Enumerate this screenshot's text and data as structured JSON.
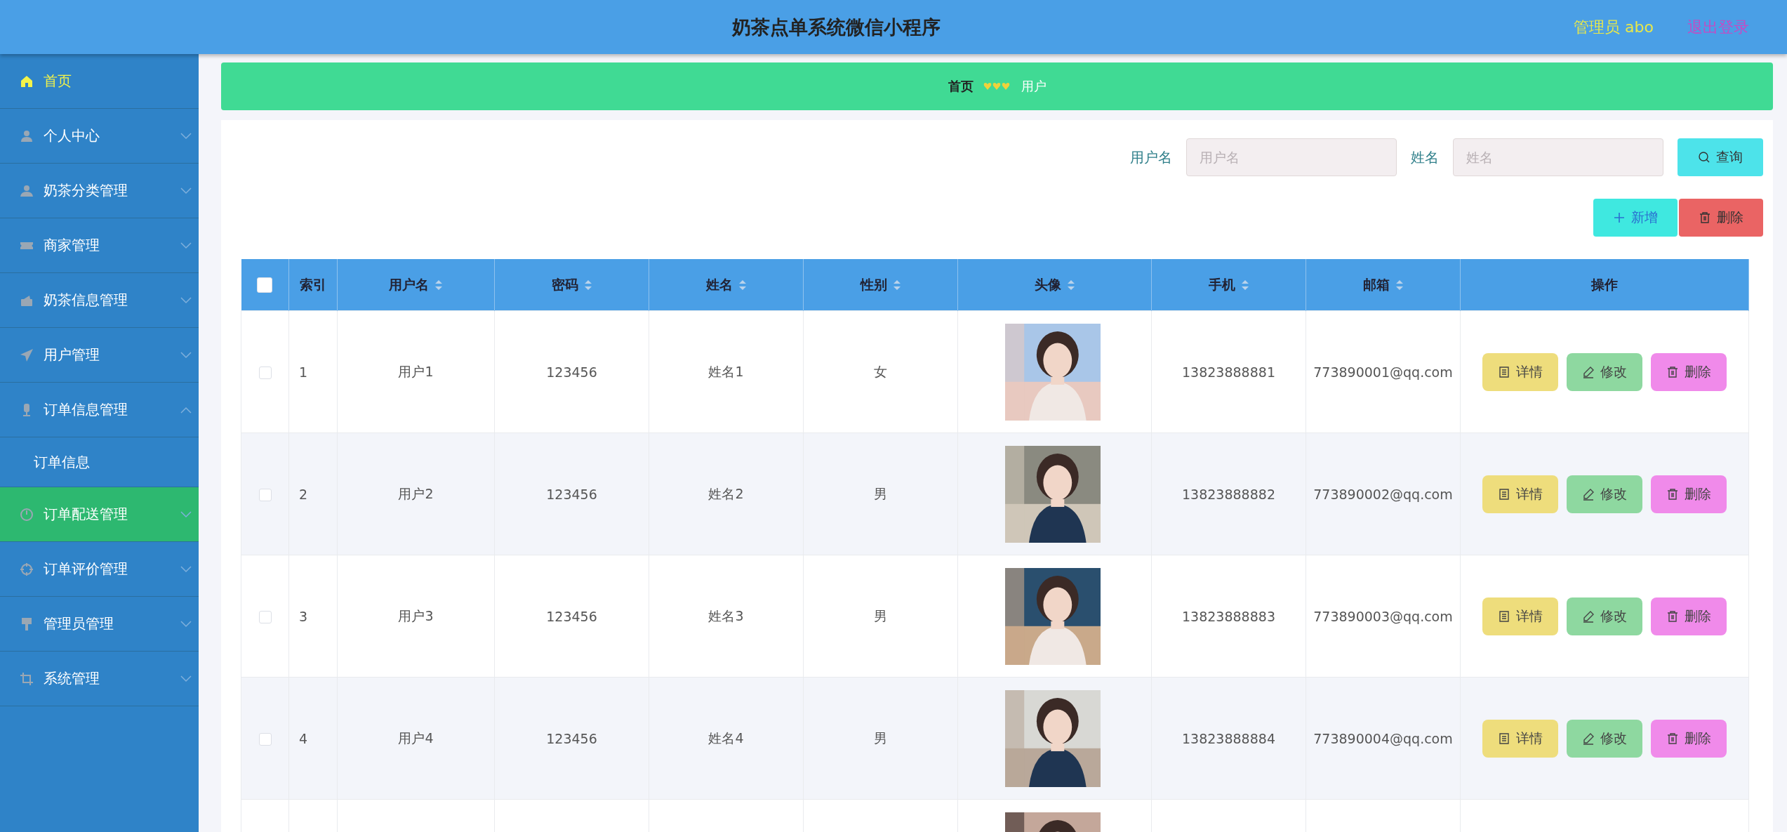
{
  "header": {
    "title": "奶茶点单系统微信小程序",
    "user": "管理员 abo",
    "logout": "退出登录"
  },
  "sidebar": {
    "items": [
      {
        "label": "首页",
        "selected": true,
        "highlighted": false
      },
      {
        "label": "个人中心",
        "selected": false,
        "highlighted": false,
        "expanded": false
      },
      {
        "label": "奶茶分类管理",
        "selected": false,
        "highlighted": false,
        "expanded": false
      },
      {
        "label": "商家管理",
        "selected": false,
        "highlighted": false,
        "expanded": false
      },
      {
        "label": "奶茶信息管理",
        "selected": false,
        "highlighted": false,
        "expanded": false
      },
      {
        "label": "用户管理",
        "selected": false,
        "highlighted": false,
        "expanded": false
      },
      {
        "label": "订单信息管理",
        "selected": false,
        "highlighted": false,
        "expanded": true,
        "children": [
          {
            "label": "订单信息"
          }
        ]
      },
      {
        "label": "订单配送管理",
        "selected": false,
        "highlighted": true,
        "expanded": false
      },
      {
        "label": "订单评价管理",
        "selected": false,
        "highlighted": false,
        "expanded": false
      },
      {
        "label": "管理员管理",
        "selected": false,
        "highlighted": false,
        "expanded": false
      },
      {
        "label": "系统管理",
        "selected": false,
        "highlighted": false,
        "expanded": false
      }
    ]
  },
  "breadcrumb": {
    "home": "首页",
    "current": "用户"
  },
  "search": {
    "fields": [
      {
        "label": "用户名",
        "placeholder": "用户名"
      },
      {
        "label": "姓名",
        "placeholder": "姓名"
      }
    ],
    "button": "查询"
  },
  "actions": [
    {
      "kind": "add",
      "label": "新增"
    },
    {
      "kind": "delete",
      "label": "删除"
    }
  ],
  "table": {
    "columns": [
      {
        "kind": "check",
        "checked": false
      },
      {
        "kind": "plain",
        "label": "索引"
      },
      {
        "kind": "sort",
        "label": "用户名"
      },
      {
        "kind": "sort",
        "label": "密码"
      },
      {
        "kind": "sort",
        "label": "姓名"
      },
      {
        "kind": "sort",
        "label": "性别"
      },
      {
        "kind": "sort",
        "label": "头像"
      },
      {
        "kind": "sort",
        "label": "手机"
      },
      {
        "kind": "sort",
        "label": "邮箱"
      },
      {
        "kind": "plain",
        "label": "操作"
      }
    ],
    "rows": [
      {
        "checked": false,
        "index": "1",
        "username": "用户1",
        "password": "123456",
        "name": "姓名1",
        "gender": "女",
        "avatar": {
          "kind": "picture"
        },
        "phone": "13823888881",
        "email": "773890001@qq.com",
        "buttons": [
          {
            "kind": "detail",
            "label": "详情"
          },
          {
            "kind": "edit",
            "label": "修改"
          },
          {
            "kind": "delete",
            "label": "删除"
          }
        ]
      },
      {
        "checked": false,
        "index": "2",
        "username": "用户2",
        "password": "123456",
        "name": "姓名2",
        "gender": "男",
        "avatar": {
          "kind": "picture"
        },
        "phone": "13823888882",
        "email": "773890002@qq.com",
        "buttons": [
          {
            "kind": "detail",
            "label": "详情"
          },
          {
            "kind": "edit",
            "label": "修改"
          },
          {
            "kind": "delete",
            "label": "删除"
          }
        ]
      },
      {
        "checked": false,
        "index": "3",
        "username": "用户3",
        "password": "123456",
        "name": "姓名3",
        "gender": "男",
        "avatar": {
          "kind": "picture"
        },
        "phone": "13823888883",
        "email": "773890003@qq.com",
        "buttons": [
          {
            "kind": "detail",
            "label": "详情"
          },
          {
            "kind": "edit",
            "label": "修改"
          },
          {
            "kind": "delete",
            "label": "删除"
          }
        ]
      },
      {
        "checked": false,
        "index": "4",
        "username": "用户4",
        "password": "123456",
        "name": "姓名4",
        "gender": "男",
        "avatar": {
          "kind": "picture"
        },
        "phone": "13823888884",
        "email": "773890004@qq.com",
        "buttons": [
          {
            "kind": "detail",
            "label": "详情"
          },
          {
            "kind": "edit",
            "label": "修改"
          },
          {
            "kind": "delete",
            "label": "删除"
          }
        ]
      },
      {
        "avatar": {
          "kind": "picture"
        }
      }
    ]
  }
}
